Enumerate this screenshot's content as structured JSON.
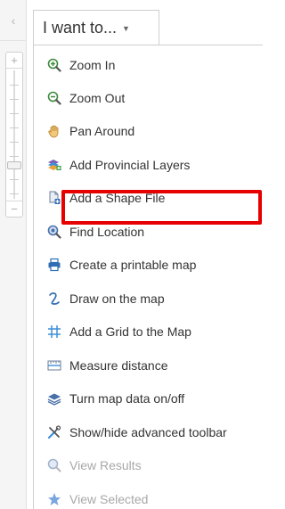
{
  "collapse": {
    "icon": "chevron-left-icon",
    "glyph": "‹"
  },
  "zoom": {
    "plus": "+",
    "minus": "−"
  },
  "dropdown": {
    "label": "I want to...",
    "caret": "▼"
  },
  "menu": {
    "items": [
      {
        "label": "Zoom In",
        "icon": "zoom-in-icon",
        "enabled": true
      },
      {
        "label": "Zoom Out",
        "icon": "zoom-out-icon",
        "enabled": true
      },
      {
        "label": "Pan Around",
        "icon": "hand-icon",
        "enabled": true
      },
      {
        "label": "Add Provincial Layers",
        "icon": "add-layers-icon",
        "enabled": true,
        "highlighted": true
      },
      {
        "label": "Add a Shape File",
        "icon": "add-file-icon",
        "enabled": true
      },
      {
        "label": "Find Location",
        "icon": "find-location-icon",
        "enabled": true
      },
      {
        "label": "Create a printable map",
        "icon": "printer-icon",
        "enabled": true
      },
      {
        "label": "Draw on the map",
        "icon": "draw-icon",
        "enabled": true
      },
      {
        "label": "Add a Grid to the Map",
        "icon": "grid-icon",
        "enabled": true
      },
      {
        "label": "Measure distance",
        "icon": "ruler-icon",
        "enabled": true
      },
      {
        "label": "Turn map data on/off",
        "icon": "layers-icon",
        "enabled": true
      },
      {
        "label": "Show/hide advanced toolbar",
        "icon": "tools-icon",
        "enabled": true
      },
      {
        "label": "View Results",
        "icon": "search-results-icon",
        "enabled": false
      },
      {
        "label": "View Selected",
        "icon": "star-icon",
        "enabled": false
      }
    ]
  },
  "colors": {
    "highlight": "#e60000",
    "accent_blue": "#2f6db5",
    "disabled": "#a8a8a8"
  }
}
